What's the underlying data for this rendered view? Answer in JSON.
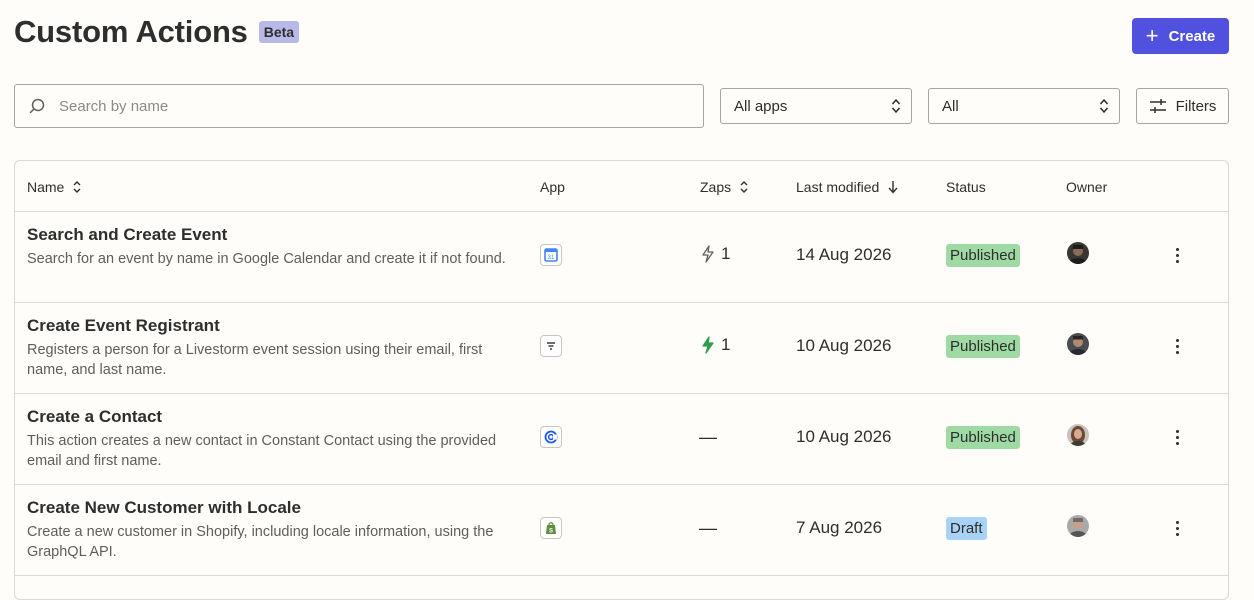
{
  "header": {
    "title": "Custom Actions",
    "badge": "Beta",
    "create_label": "Create"
  },
  "search": {
    "placeholder": "Search by name"
  },
  "filters": {
    "apps_selected": "All apps",
    "status_selected": "All",
    "filters_label": "Filters"
  },
  "table": {
    "columns": {
      "name": "Name",
      "app": "App",
      "zaps": "Zaps",
      "modified": "Last modified",
      "status": "Status",
      "owner": "Owner"
    },
    "rows": [
      {
        "name": "Search and Create Event",
        "description": "Search for an event by name in Google Calendar and create it if not found.",
        "app_icon": "google-calendar-icon",
        "zaps": "1",
        "zaps_active": false,
        "modified": "14 Aug 2026",
        "status": "Published"
      },
      {
        "name": "Create Event Registrant",
        "description": "Registers a person for a Livestorm event session using their email, first name, and last name.",
        "app_icon": "livestorm-icon",
        "zaps": "1",
        "zaps_active": true,
        "modified": "10 Aug 2026",
        "status": "Published"
      },
      {
        "name": "Create a Contact",
        "description": "This action creates a new contact in Constant Contact using the provided email and first name.",
        "app_icon": "constant-contact-icon",
        "zaps": "—",
        "zaps_active": false,
        "modified": "10 Aug 2026",
        "status": "Published"
      },
      {
        "name": "Create New Customer with Locale",
        "description": "Create a new customer in Shopify, including locale information, using the GraphQL API.",
        "app_icon": "shopify-icon",
        "zaps": "—",
        "zaps_active": false,
        "modified": "7 Aug 2026",
        "status": "Draft"
      }
    ]
  },
  "colors": {
    "accent": "#5151e0",
    "published": "#9fd9a3",
    "draft": "#a8d3f5",
    "zap_active": "#2e9e4f"
  }
}
